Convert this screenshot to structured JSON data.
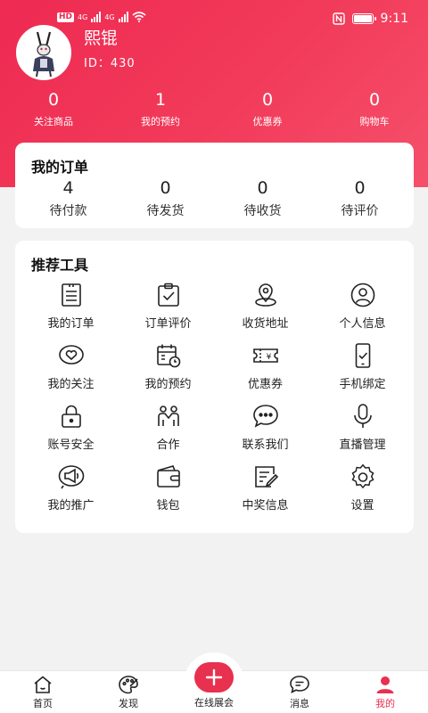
{
  "status_bar": {
    "network": "4G",
    "hd": "HD",
    "time": "9:11"
  },
  "profile": {
    "name": "熙锟",
    "id": "ID：430",
    "avatar": "rabbit-avatar"
  },
  "stats": [
    {
      "value": "0",
      "label": "关注商品"
    },
    {
      "value": "1",
      "label": "我的预约"
    },
    {
      "value": "0",
      "label": "优惠券"
    },
    {
      "value": "0",
      "label": "购物车"
    }
  ],
  "orders": {
    "title": "我的订单",
    "items": [
      {
        "value": "4",
        "label": "待付款"
      },
      {
        "value": "0",
        "label": "待发货"
      },
      {
        "value": "0",
        "label": "待收货"
      },
      {
        "value": "0",
        "label": "待评价"
      }
    ]
  },
  "tools": {
    "title": "推荐工具",
    "items": [
      {
        "label": "我的订单",
        "icon": "order-list-icon"
      },
      {
        "label": "订单评价",
        "icon": "clipboard-check-icon"
      },
      {
        "label": "收货地址",
        "icon": "location-pin-icon"
      },
      {
        "label": "个人信息",
        "icon": "user-circle-icon"
      },
      {
        "label": "我的关注",
        "icon": "heart-bubble-icon"
      },
      {
        "label": "我的预约",
        "icon": "calendar-clock-icon"
      },
      {
        "label": "优惠券",
        "icon": "coupon-icon"
      },
      {
        "label": "手机绑定",
        "icon": "phone-check-icon"
      },
      {
        "label": "账号安全",
        "icon": "lock-icon"
      },
      {
        "label": "合作",
        "icon": "partners-icon"
      },
      {
        "label": "联系我们",
        "icon": "chat-bubble-icon"
      },
      {
        "label": "直播管理",
        "icon": "microphone-icon"
      },
      {
        "label": "我的推广",
        "icon": "megaphone-icon"
      },
      {
        "label": "钱包",
        "icon": "wallet-icon"
      },
      {
        "label": "中奖信息",
        "icon": "note-edit-icon"
      },
      {
        "label": "设置",
        "icon": "settings-icon"
      }
    ]
  },
  "tabbar": {
    "home": "首页",
    "discover": "发现",
    "online_expo": "在线展会",
    "messages": "消息",
    "mine": "我的"
  },
  "colors": {
    "accent": "#e8304f",
    "header_gradient_start": "#ee2a52",
    "header_gradient_end": "#f5506b",
    "background": "#f2f2f2"
  }
}
